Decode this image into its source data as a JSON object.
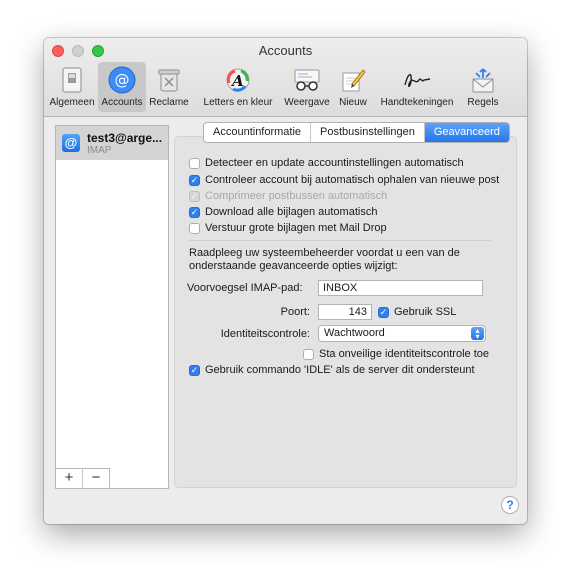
{
  "window": {
    "title": "Accounts"
  },
  "toolbar": {
    "items": [
      {
        "label": "Algemeen",
        "icon": "switch-icon"
      },
      {
        "label": "Accounts",
        "icon": "at-sign-icon"
      },
      {
        "label": "Reclame",
        "icon": "trash-icon"
      },
      {
        "label": "Letters en kleur",
        "icon": "font-color-icon"
      },
      {
        "label": "Weergave",
        "icon": "glasses-icon"
      },
      {
        "label": "Nieuw",
        "icon": "pencil-note-icon"
      },
      {
        "label": "Handtekeningen",
        "icon": "signature-icon"
      },
      {
        "label": "Regels",
        "icon": "envelope-rules-icon"
      }
    ],
    "active": "Accounts"
  },
  "sidebar": {
    "account_name": "test3@arge...",
    "account_type": "IMAP",
    "add_label": "+",
    "remove_label": "−"
  },
  "tabs": [
    {
      "label": "Accountinformatie",
      "selected": false
    },
    {
      "label": "Postbusinstellingen",
      "selected": false
    },
    {
      "label": "Geavanceerd",
      "selected": true
    }
  ],
  "options": {
    "detect": {
      "label": "Detecteer en update accountinstellingen automatisch",
      "checked": false
    },
    "check_account": {
      "label": "Controleer account bij automatisch ophalen van nieuwe post",
      "checked": true
    },
    "compress": {
      "label": "Comprimeer postbussen automatisch",
      "checked": true,
      "disabled": true
    },
    "download": {
      "label": "Download alle bijlagen automatisch",
      "checked": true
    },
    "maildrop": {
      "label": "Verstuur grote bijlagen met Mail Drop",
      "checked": false
    }
  },
  "note": "Raadpleeg uw systeembeheerder voordat u een van de onderstaande geavanceerde opties wijzigt:",
  "imap_prefix": {
    "label": "Voorvoegsel IMAP-pad:",
    "value": "INBOX"
  },
  "port": {
    "label": "Poort:",
    "value": "143"
  },
  "ssl": {
    "label": "Gebruik SSL",
    "checked": true
  },
  "auth": {
    "label": "Identiteitscontrole:",
    "value": "Wachtwoord"
  },
  "insecure_auth": {
    "label": "Sta onveilige identiteitscontrole toe",
    "checked": false
  },
  "idle": {
    "label": "Gebruik commando 'IDLE' als de server dit ondersteunt",
    "checked": true
  },
  "help": {
    "label": "?"
  },
  "colors": {
    "accent": "#2f7ff0",
    "close": "#fc605c",
    "zoom": "#34c84a"
  }
}
